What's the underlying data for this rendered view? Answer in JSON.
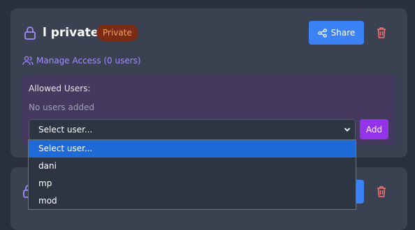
{
  "card": {
    "title": "l private",
    "badge": "Private",
    "share_label": "Share",
    "manage_access_label": "Manage Access (0 users)",
    "allowed_users_label": "Allowed Users:",
    "empty_message": "No users added",
    "select_value": "Select user...",
    "add_label": "Add"
  },
  "dropdown": {
    "options": [
      "Select user...",
      "dani",
      "mp",
      "mod"
    ],
    "selected_index": 0
  },
  "colors": {
    "background": "#2a303c",
    "card": "#3a4252",
    "accent_blue": "#3b82f6",
    "accent_purple": "#9333ea",
    "link_purple": "#a78bfa",
    "danger": "#f87171",
    "badge_bg": "#7a2d14",
    "badge_text": "#f39a6c"
  },
  "icons": {
    "lock": "lock-icon",
    "share": "share-icon",
    "trash": "trash-icon",
    "users": "users-icon",
    "chevron": "chevron-down-icon"
  }
}
